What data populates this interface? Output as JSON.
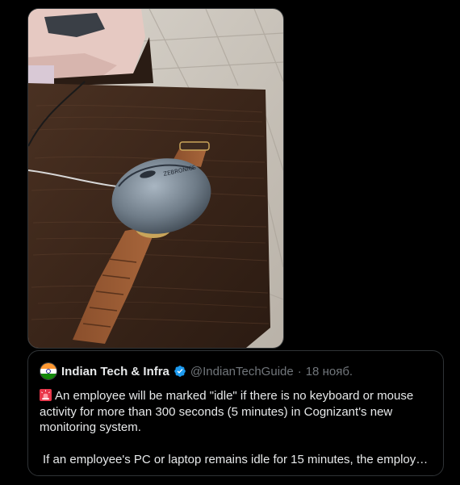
{
  "media": {
    "icon": "photo-of-mouse-and-watch-on-table"
  },
  "quote": {
    "author_name": "Indian Tech & Infra",
    "handle": "@IndianTechGuide",
    "separator": "·",
    "date": "18 нояб.",
    "avatar_icon": "india-flag-avatar",
    "verified_icon": "verified-badge-icon",
    "verified_color": "#1d9bf0",
    "emoji_icon": "rotating-light-emoji",
    "paragraph_1": "An employee will be marked \"idle\" if there is no keyboard or mouse activity for more than 300 seconds (5 minutes) in Cognizant's new monitoring system.",
    "paragraph_2": "If an employee's PC or laptop remains idle for 15 minutes, the employ…"
  },
  "colors": {
    "background": "#000000",
    "text_primary": "#e7e9ea",
    "text_secondary": "#71767b",
    "border": "#2f3336"
  }
}
